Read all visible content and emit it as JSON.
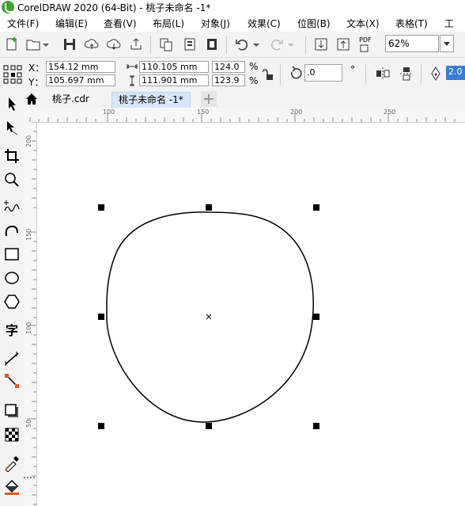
{
  "window": {
    "title": "CorelDRAW 2020 (64-Bit) - 桃子未命名 -1*"
  },
  "menu": [
    "文件(F)",
    "编辑(E)",
    "查看(V)",
    "布局(L)",
    "对象(J)",
    "效果(C)",
    "位图(B)",
    "文本(X)",
    "表格(T)",
    "工"
  ],
  "toolbar": {
    "zoom_value": "62%",
    "pdf_label": "PDF"
  },
  "propbar": {
    "x_label": "X：",
    "x_value": "154.12 mm",
    "y_label": "Y：",
    "y_value": "105.697 mm",
    "width_value": "110.105 mm",
    "height_value": "111.901 mm",
    "scale_w": "124.0",
    "scale_h": "123.9",
    "percent": "%",
    "rotation_value": ".0",
    "outline_value": "2.0"
  },
  "tabs": [
    {
      "label": "桃子.cdr",
      "active": false
    },
    {
      "label": "桃子未命名 -1*",
      "active": true
    }
  ],
  "ruler_h": [
    {
      "label": "100"
    },
    {
      "label": "150"
    },
    {
      "label": "200"
    },
    {
      "label": "250"
    }
  ],
  "ruler_v": [
    {
      "label": "200"
    },
    {
      "label": "150"
    },
    {
      "label": "100"
    },
    {
      "label": "50"
    }
  ],
  "icons": {
    "new": "new-document-icon",
    "open": "open-folder-icon",
    "save": "save-icon",
    "zoom": "zoom-icon",
    "select": "pick-tool-icon"
  }
}
